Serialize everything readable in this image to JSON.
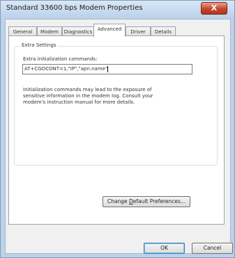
{
  "window": {
    "title": "Standard 33600 bps Modem Properties",
    "close_label": "X"
  },
  "tabs": [
    {
      "label": "General"
    },
    {
      "label": "Modem"
    },
    {
      "label": "Diagnostics"
    },
    {
      "label": "Advanced"
    },
    {
      "label": "Driver"
    },
    {
      "label": "Details"
    }
  ],
  "active_tab": "Advanced",
  "group": {
    "label": "Extra Settings",
    "field_label": "Extra initialization commands:",
    "field_value": "AT+CGDCONT=1,\"IP\",\"apn.name\"",
    "info_text": "Initialization commands may lead to the exposure of sensitive information in the modem log. Consult your modem's instruction manual for more details."
  },
  "buttons": {
    "preferences_before": "Change ",
    "preferences_mnemonic": "D",
    "preferences_after": "efault Preferences...",
    "ok": "OK",
    "cancel": "Cancel"
  }
}
